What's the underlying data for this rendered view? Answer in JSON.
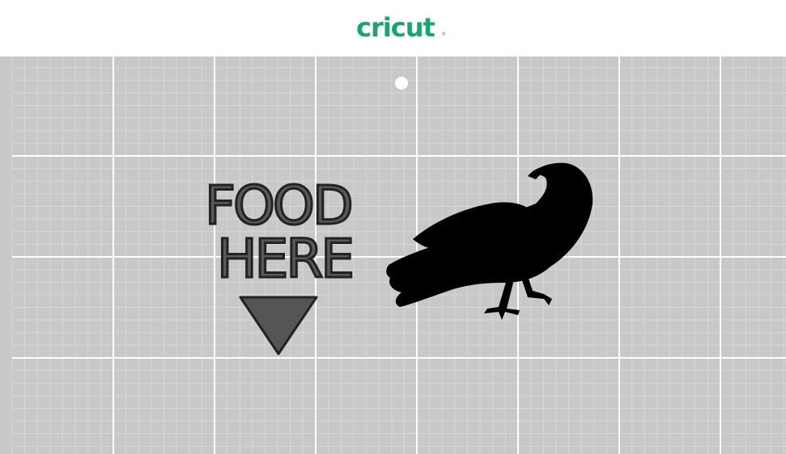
{
  "brand": {
    "logo_text": "cricut",
    "registered_mark": "®",
    "color": "#1aa56e"
  },
  "mat": {
    "background_color": "#c8c8c8",
    "major_grid_color": "#ffffff",
    "minor_grid_color": "#d8d8d8"
  },
  "design": {
    "line1": "FOOD",
    "line2": "HERE",
    "text_fill": "#595959",
    "arrow_fill": "#555555",
    "arrow_icon": "down-triangle-icon",
    "raven_icon": "raven-silhouette-icon",
    "raven_fill": "#000000"
  }
}
